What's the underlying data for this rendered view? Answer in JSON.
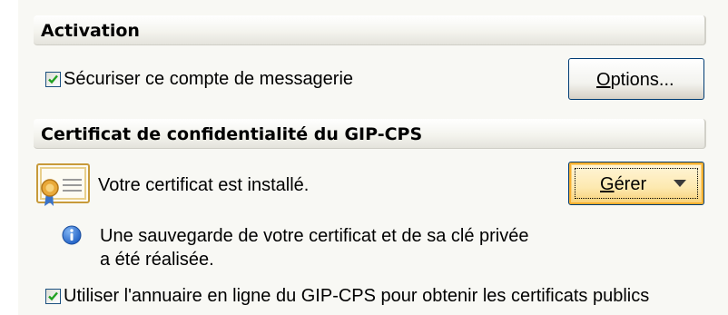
{
  "activation": {
    "header": "Activation",
    "secure_account": {
      "label": "Sécuriser ce compte de messagerie",
      "checked": true
    },
    "options_button": {
      "label_underlined": "O",
      "label_rest": "ptions..."
    }
  },
  "certificate": {
    "header": "Certificat de confidentialité du GIP-CPS",
    "icon": "certificate-icon",
    "status": "Votre certificat est installé.",
    "manage_button": {
      "label_underlined": "G",
      "label_rest": "érer",
      "icon": "dropdown-arrow-icon"
    },
    "backup_info": {
      "icon": "info-icon",
      "line1": "Une sauvegarde de votre certificat et de sa clé privée",
      "line2": "a été réalisée."
    },
    "use_directory": {
      "label": "Utiliser l'annuaire en ligne du GIP-CPS pour obtenir les certificats publics",
      "checked": true
    }
  },
  "colors": {
    "panel_bg": "#f8f8f4",
    "focus_orange": "#f8b030",
    "info_blue": "#1f5fc4",
    "checkbox_border": "#1c5180",
    "check_mark": "#21a121"
  }
}
